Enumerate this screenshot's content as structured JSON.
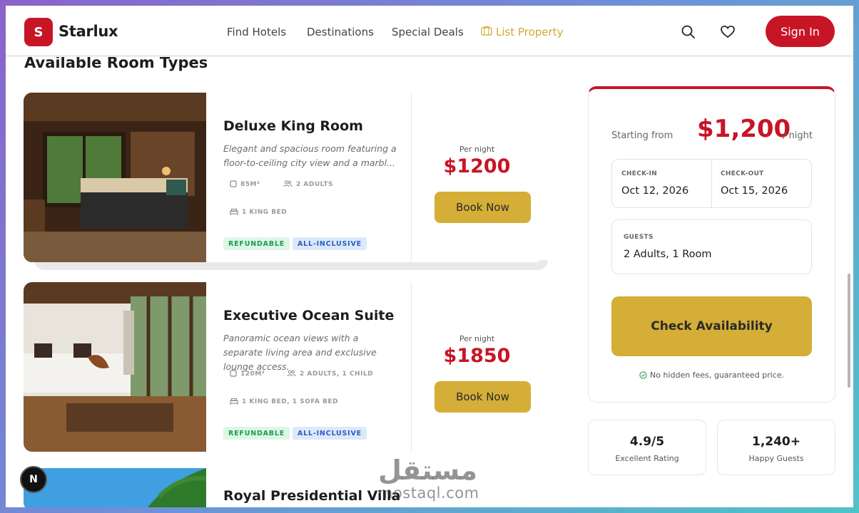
{
  "header": {
    "logo_letter": "S",
    "brand": "Starlux",
    "nav": [
      "Find Hotels",
      "Destinations",
      "Special Deals",
      "List Property"
    ],
    "sign_in": "Sign In"
  },
  "section_title": "Available Room Types",
  "rooms": [
    {
      "name": "Deluxe King Room",
      "description": "Elegant and spacious room featuring a floor-to-ceiling city view and a marbl...",
      "size": "85M²",
      "occupancy": "2 ADULTS",
      "beds": "1 KING BED",
      "tags": [
        "REFUNDABLE",
        "ALL-INCLUSIVE"
      ],
      "per_night_label": "Per night",
      "price": "$1200",
      "book_label": "Book Now"
    },
    {
      "name": "Executive Ocean Suite",
      "description": "Panoramic ocean views with a separate living area and exclusive lounge access.",
      "size": "120M²",
      "occupancy": "2 ADULTS, 1 CHILD",
      "beds": "1 KING BED, 1 SOFA BED",
      "tags": [
        "REFUNDABLE",
        "ALL-INCLUSIVE"
      ],
      "per_night_label": "Per night",
      "price": "$1850",
      "book_label": "Book Now"
    },
    {
      "name": "Royal Presidential Villa"
    }
  ],
  "booking": {
    "starting_from": "Starting from",
    "price": "$1,200",
    "per_night": "/ night",
    "checkin_label": "CHECK-IN",
    "checkin_value": "Oct 12, 2026",
    "checkout_label": "CHECK-OUT",
    "checkout_value": "Oct 15, 2026",
    "guests_label": "GUESTS",
    "guests_value": "2 Adults, 1 Room",
    "cta": "Check Availability",
    "note": "No hidden fees, guaranteed price."
  },
  "stats": [
    {
      "value": "4.9/5",
      "label": "Excellent Rating"
    },
    {
      "value": "1,240+",
      "label": "Happy Guests"
    }
  ],
  "badge_letter": "N",
  "watermark": {
    "arabic": "مستقل",
    "latin": "mostaql.com"
  },
  "colors": {
    "brand_red": "#c81526",
    "gold": "#d4ae37"
  }
}
